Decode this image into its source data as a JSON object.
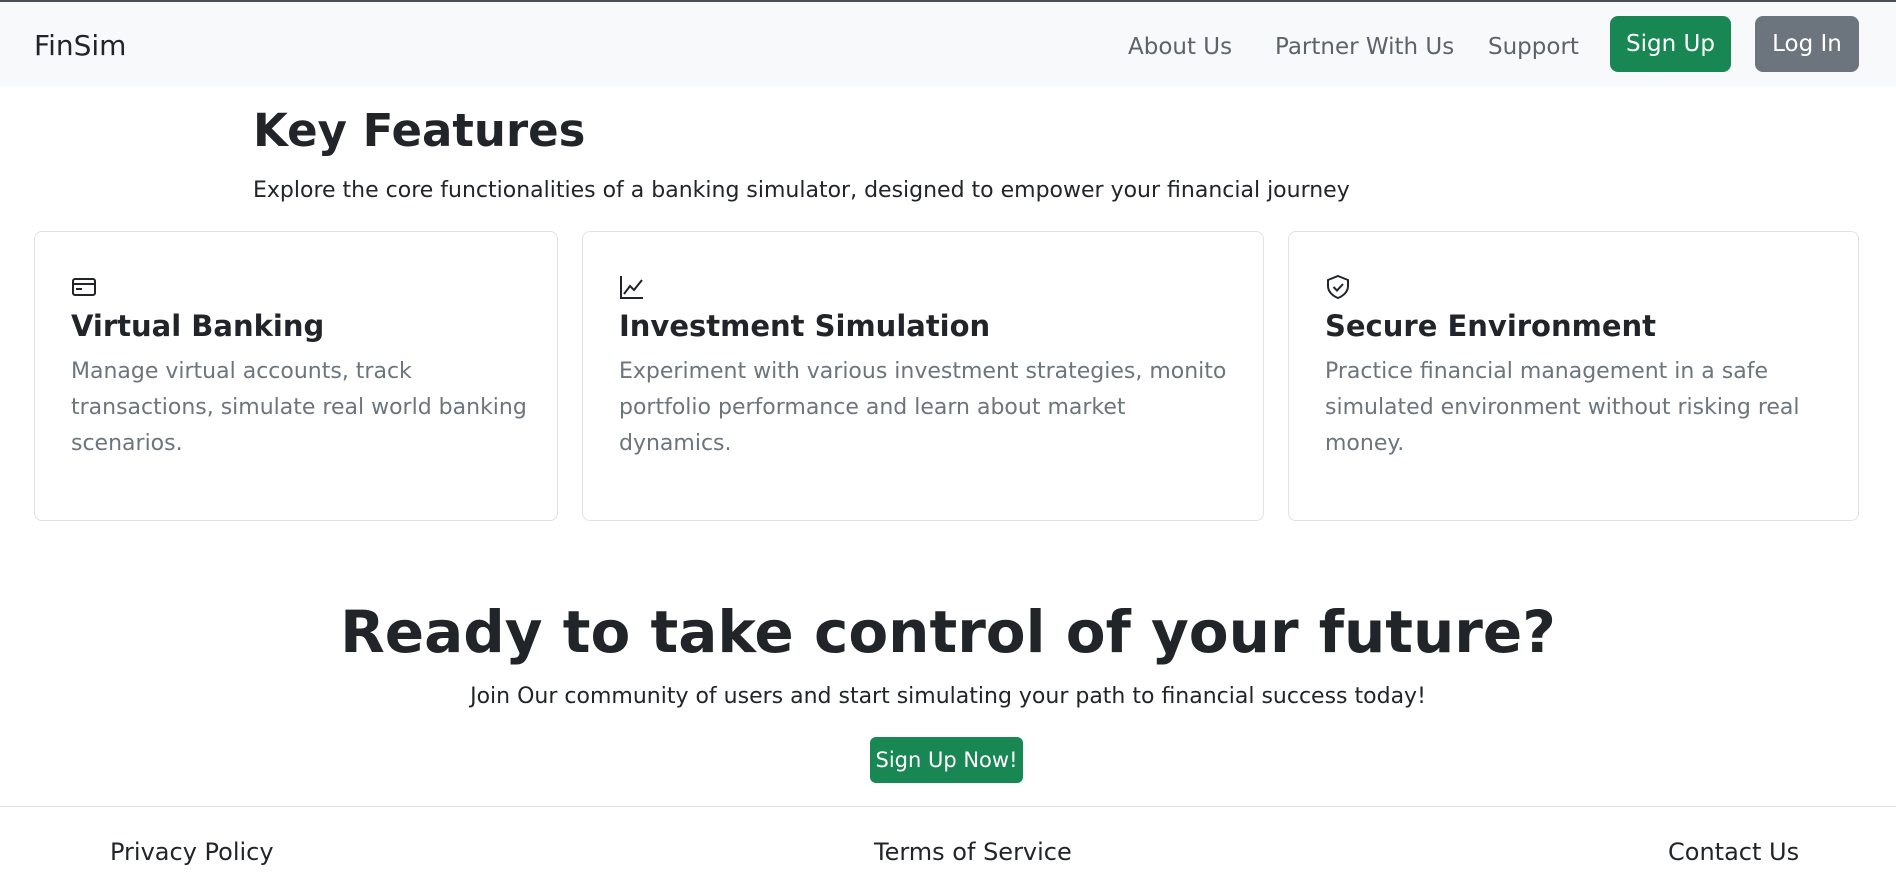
{
  "navbar": {
    "brand": "FinSim",
    "links": [
      "About Us",
      "Partner With Us",
      "Support"
    ],
    "signup_label": "Sign Up",
    "login_label": "Log In"
  },
  "features": {
    "title": "Key Features",
    "subtitle": "Explore the core functionalities of a banking simulator, designed to empower your financial journey",
    "cards": [
      {
        "icon": "credit-card-icon",
        "title": "Virtual Banking",
        "text": "Manage virtual accounts, track transactions, simulate real world banking scenarios."
      },
      {
        "icon": "line-chart-icon",
        "title": "Investment Simulation",
        "text": "Experiment with various investment strategies, monito portfolio performance and learn about market dynamics."
      },
      {
        "icon": "shield-check-icon",
        "title": "Secure Environment",
        "text": "Practice financial management in a safe simulated environment without risking real money."
      }
    ]
  },
  "cta": {
    "title": "Ready to take control of your future?",
    "text": "Join Our community of users and start simulating your path to financial success today!",
    "button_label": "Sign Up Now!"
  },
  "footer": {
    "links": [
      "Privacy Policy",
      "Terms of Service",
      "Contact Us"
    ]
  },
  "colors": {
    "primary_green": "#198754",
    "secondary_gray": "#6c757d",
    "navbar_bg": "#f8f9fa",
    "text_dark": "#212529",
    "text_muted": "#6c757d",
    "border": "#dee2e6"
  }
}
